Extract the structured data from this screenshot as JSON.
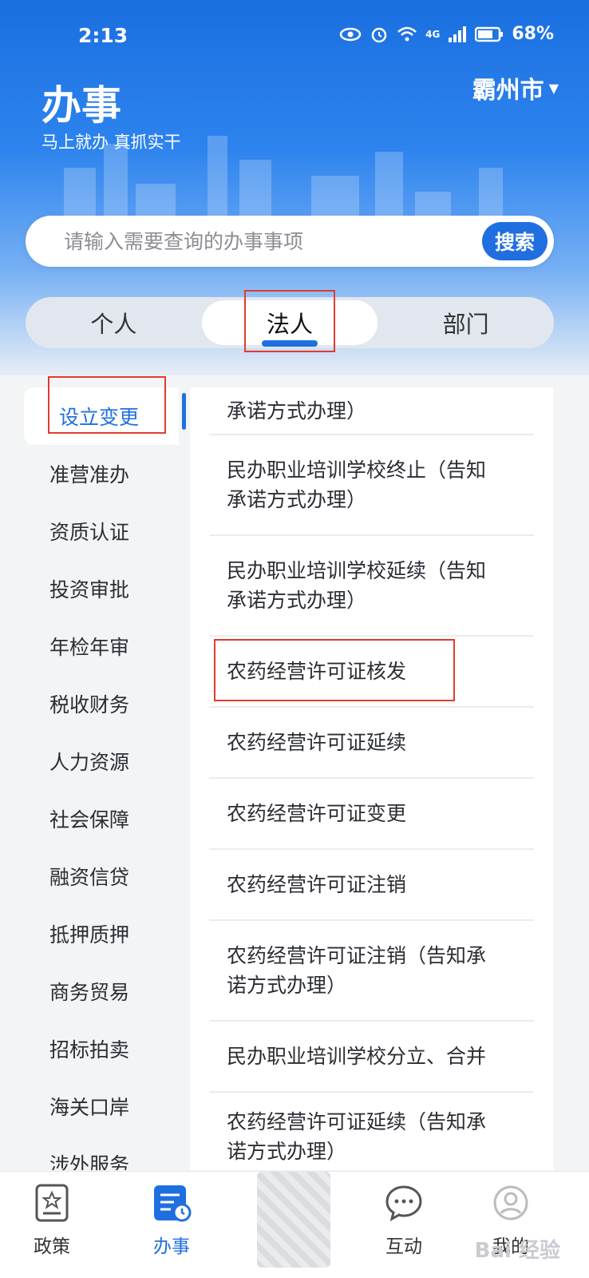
{
  "status_bar": {
    "time": "2:13",
    "network": "4G",
    "battery": "68%"
  },
  "header": {
    "title": "办事",
    "slogan": "马上就办 真抓实干",
    "city": "霸州市",
    "city_caret": "▼"
  },
  "search": {
    "placeholder": "请输入需要查询的办事事项",
    "button": "搜索"
  },
  "tabs": [
    {
      "label": "个人"
    },
    {
      "label": "法人"
    },
    {
      "label": "部门"
    }
  ],
  "sidebar": {
    "items": [
      {
        "label": "设立变更"
      },
      {
        "label": "准营准办"
      },
      {
        "label": "资质认证"
      },
      {
        "label": "投资审批"
      },
      {
        "label": "年检年审"
      },
      {
        "label": "税收财务"
      },
      {
        "label": "人力资源"
      },
      {
        "label": "社会保障"
      },
      {
        "label": "融资信贷"
      },
      {
        "label": "抵押质押"
      },
      {
        "label": "商务贸易"
      },
      {
        "label": "招标拍卖"
      },
      {
        "label": "海关口岸"
      },
      {
        "label": "涉外服务"
      }
    ]
  },
  "list": {
    "items": [
      {
        "line1": "承诺方式办理）",
        "line2": ""
      },
      {
        "line1": "民办职业培训学校终止（告知",
        "line2": "承诺方式办理）"
      },
      {
        "line1": "民办职业培训学校延续（告知",
        "line2": "承诺方式办理）"
      },
      {
        "line1": "农药经营许可证核发",
        "line2": ""
      },
      {
        "line1": "农药经营许可证延续",
        "line2": ""
      },
      {
        "line1": "农药经营许可证变更",
        "line2": ""
      },
      {
        "line1": "农药经营许可证注销",
        "line2": ""
      },
      {
        "line1": "农药经营许可证注销（告知承",
        "line2": "诺方式办理）"
      },
      {
        "line1": "民办职业培训学校分立、合并",
        "line2": ""
      },
      {
        "line1": "农药经营许可证延续（告知承",
        "line2": "诺方式办理）"
      }
    ]
  },
  "tabbar": {
    "items": [
      {
        "label": "政策",
        "icon": "policy-icon"
      },
      {
        "label": "办事",
        "icon": "service-icon"
      },
      {
        "label": "互动",
        "icon": "chat-icon"
      },
      {
        "label": "我的",
        "icon": "user-icon"
      }
    ]
  },
  "watermark": "Bai 经验",
  "colors": {
    "accent": "#1f6fe0",
    "annotation": "#e23b2e"
  }
}
